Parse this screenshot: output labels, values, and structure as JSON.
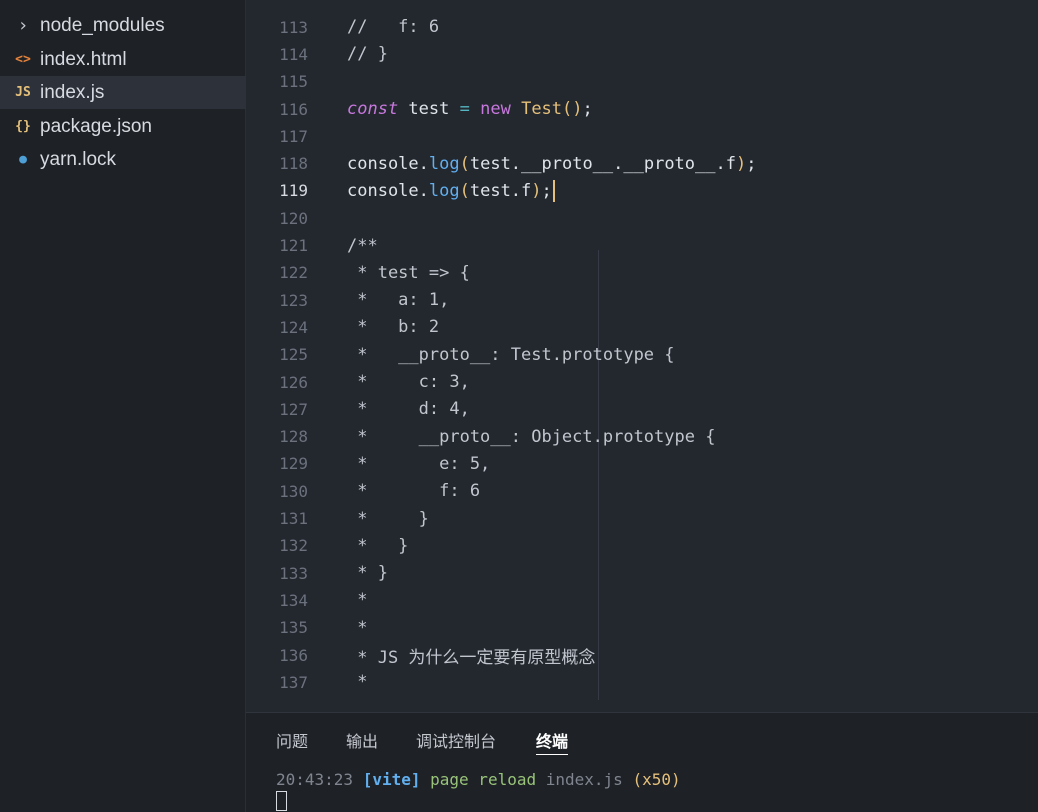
{
  "sidebar": {
    "items": [
      {
        "icon": "chevron-right-icon",
        "label": "node_modules",
        "icon_glyph": "›",
        "icon_color": "#c5c9d0"
      },
      {
        "icon": "html-file-icon",
        "label": "index.html",
        "icon_glyph": "<>",
        "icon_color": "#e8833a"
      },
      {
        "icon": "js-file-icon",
        "label": "index.js",
        "icon_glyph": "JS",
        "icon_color": "#e5c07b"
      },
      {
        "icon": "json-file-icon",
        "label": "package.json",
        "icon_glyph": "{}",
        "icon_color": "#e5c07b"
      },
      {
        "icon": "yarn-file-icon",
        "label": "yarn.lock",
        "icon_glyph": "●",
        "icon_color": "#4d9fd6"
      }
    ],
    "active_index": 2
  },
  "editor": {
    "current_line": "119",
    "lines": [
      {
        "no": "113",
        "text": "//   f: 6"
      },
      {
        "no": "114",
        "text": "// }"
      },
      {
        "no": "115",
        "text": ""
      },
      {
        "no": "116",
        "text": "const test = new Test();"
      },
      {
        "no": "117",
        "text": ""
      },
      {
        "no": "118",
        "text": "console.log(test.__proto__.__proto__.f);"
      },
      {
        "no": "119",
        "text": "console.log(test.f);"
      },
      {
        "no": "120",
        "text": ""
      },
      {
        "no": "121",
        "text": "/**"
      },
      {
        "no": "122",
        "text": " * test => {"
      },
      {
        "no": "123",
        "text": " *   a: 1,"
      },
      {
        "no": "124",
        "text": " *   b: 2"
      },
      {
        "no": "125",
        "text": " *   __proto__: Test.prototype {"
      },
      {
        "no": "126",
        "text": " *     c: 3,"
      },
      {
        "no": "127",
        "text": " *     d: 4,"
      },
      {
        "no": "128",
        "text": " *     __proto__: Object.prototype {"
      },
      {
        "no": "129",
        "text": " *       e: 5,"
      },
      {
        "no": "130",
        "text": " *       f: 6"
      },
      {
        "no": "131",
        "text": " *     }"
      },
      {
        "no": "132",
        "text": " *   }"
      },
      {
        "no": "133",
        "text": " * }"
      },
      {
        "no": "134",
        "text": " *"
      },
      {
        "no": "135",
        "text": " *"
      },
      {
        "no": "136",
        "text": " * JS 为什么一定要有原型概念"
      },
      {
        "no": "137",
        "text": " *"
      }
    ]
  },
  "panel": {
    "tabs": [
      "问题",
      "输出",
      "调试控制台",
      "终端"
    ],
    "active_tab": 3,
    "terminal": {
      "time": "20:43:23",
      "tag": "[vite]",
      "message": "page reload",
      "file": "index.js",
      "count": "(x50)"
    }
  },
  "colors": {
    "editor_bg": "#23272e",
    "sidebar_bg": "#1e2227",
    "cursor": "#e5c07b"
  }
}
